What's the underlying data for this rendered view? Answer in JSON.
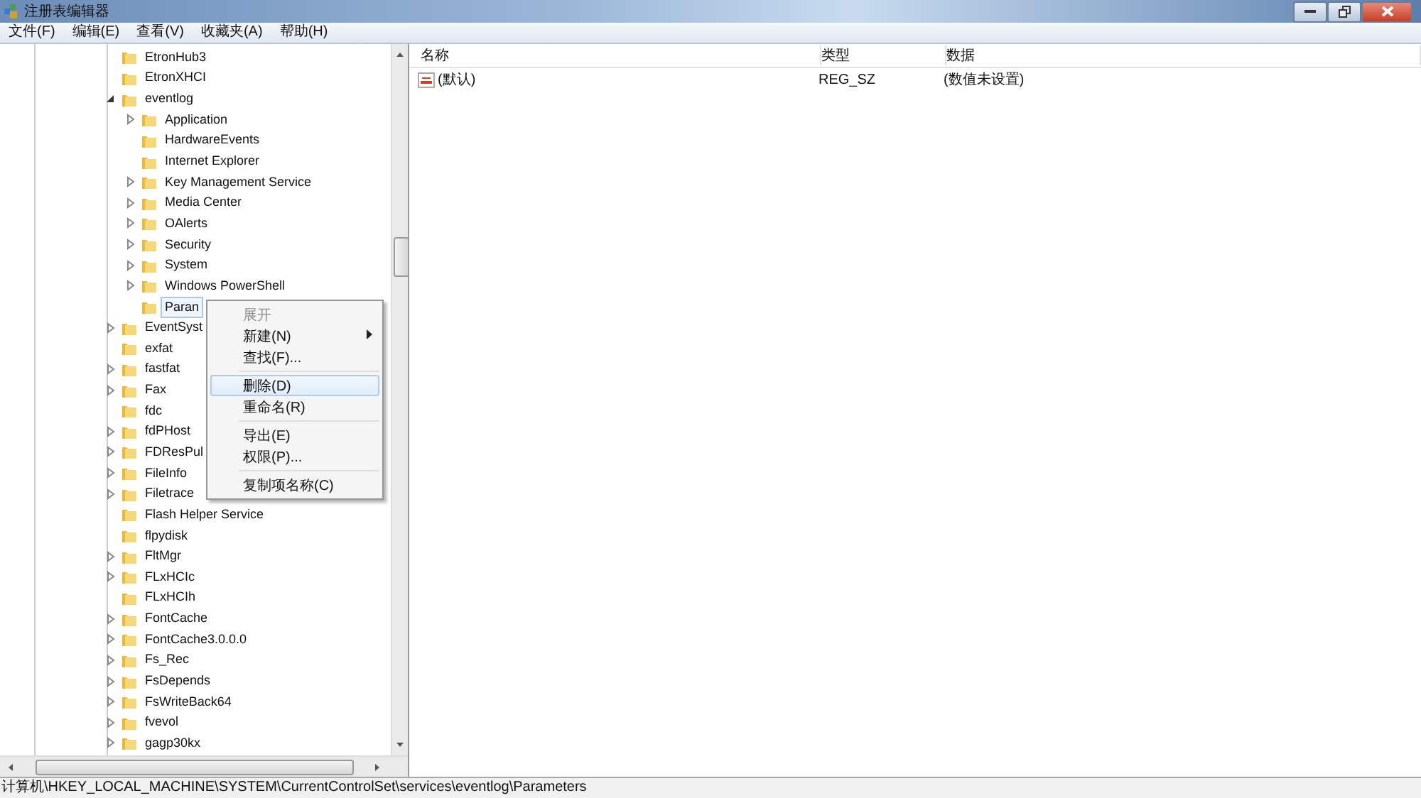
{
  "window": {
    "title": "注册表编辑器"
  },
  "menu_bar": [
    "文件(F)",
    "编辑(E)",
    "查看(V)",
    "收藏夹(A)",
    "帮助(H)"
  ],
  "tree": [
    {
      "label": "EtronHub3",
      "expandable": false,
      "selected": false
    },
    {
      "label": "EtronXHCI",
      "expandable": false,
      "selected": false
    },
    {
      "label": "eventlog",
      "expandable": true,
      "expanded": true,
      "selected": false,
      "children": [
        {
          "label": "Application",
          "expandable": true,
          "selected": false
        },
        {
          "label": "HardwareEvents",
          "expandable": false,
          "selected": false
        },
        {
          "label": "Internet Explorer",
          "expandable": false,
          "selected": false
        },
        {
          "label": "Key Management Service",
          "expandable": true,
          "selected": false
        },
        {
          "label": "Media Center",
          "expandable": true,
          "selected": false
        },
        {
          "label": "OAlerts",
          "expandable": true,
          "selected": false
        },
        {
          "label": "Security",
          "expandable": true,
          "selected": false
        },
        {
          "label": "System",
          "expandable": true,
          "selected": false
        },
        {
          "label": "Windows PowerShell",
          "expandable": true,
          "selected": false
        },
        {
          "label": "Paran",
          "expandable": false,
          "selected": true
        }
      ]
    },
    {
      "label": "EventSyst",
      "expandable": true,
      "selected": false
    },
    {
      "label": "exfat",
      "expandable": false,
      "selected": false
    },
    {
      "label": "fastfat",
      "expandable": true,
      "selected": false
    },
    {
      "label": "Fax",
      "expandable": true,
      "selected": false
    },
    {
      "label": "fdc",
      "expandable": false,
      "selected": false
    },
    {
      "label": "fdPHost",
      "expandable": true,
      "selected": false
    },
    {
      "label": "FDResPul",
      "expandable": true,
      "selected": false
    },
    {
      "label": "FileInfo",
      "expandable": true,
      "selected": false
    },
    {
      "label": "Filetrace",
      "expandable": true,
      "selected": false
    },
    {
      "label": "Flash Helper Service",
      "expandable": false,
      "selected": false
    },
    {
      "label": "flpydisk",
      "expandable": false,
      "selected": false
    },
    {
      "label": "FltMgr",
      "expandable": true,
      "selected": false
    },
    {
      "label": "FLxHCIc",
      "expandable": true,
      "selected": false
    },
    {
      "label": "FLxHCIh",
      "expandable": false,
      "selected": false
    },
    {
      "label": "FontCache",
      "expandable": true,
      "selected": false
    },
    {
      "label": "FontCache3.0.0.0",
      "expandable": true,
      "selected": false
    },
    {
      "label": "Fs_Rec",
      "expandable": true,
      "selected": false
    },
    {
      "label": "FsDepends",
      "expandable": true,
      "selected": false
    },
    {
      "label": "FsWriteBack64",
      "expandable": true,
      "selected": false
    },
    {
      "label": "fvevol",
      "expandable": true,
      "selected": false
    },
    {
      "label": "gagp30kx",
      "expandable": true,
      "selected": false
    }
  ],
  "context_menu": [
    {
      "kind": "item",
      "label": "展开",
      "disabled": true,
      "selected": false,
      "submenu": false
    },
    {
      "kind": "item",
      "label": "新建(N)",
      "disabled": false,
      "selected": false,
      "submenu": true
    },
    {
      "kind": "item",
      "label": "查找(F)...",
      "disabled": false,
      "selected": false,
      "submenu": false
    },
    {
      "kind": "separator"
    },
    {
      "kind": "item",
      "label": "删除(D)",
      "disabled": false,
      "selected": true,
      "submenu": false
    },
    {
      "kind": "item",
      "label": "重命名(R)",
      "disabled": false,
      "selected": false,
      "submenu": false
    },
    {
      "kind": "separator"
    },
    {
      "kind": "item",
      "label": "导出(E)",
      "disabled": false,
      "selected": false,
      "submenu": false
    },
    {
      "kind": "item",
      "label": "权限(P)...",
      "disabled": false,
      "selected": false,
      "submenu": false
    },
    {
      "kind": "separator"
    },
    {
      "kind": "item",
      "label": "复制项名称(C)",
      "disabled": false,
      "selected": false,
      "submenu": false
    }
  ],
  "values_table": {
    "columns": [
      "名称",
      "类型",
      "数据"
    ],
    "rows": [
      {
        "name": "(默认)",
        "type": "REG_SZ",
        "data": "(数值未设置)"
      }
    ]
  },
  "status_bar": "计算机\\HKEY_LOCAL_MACHINE\\SYSTEM\\CurrentControlSet\\services\\eventlog\\Parameters"
}
